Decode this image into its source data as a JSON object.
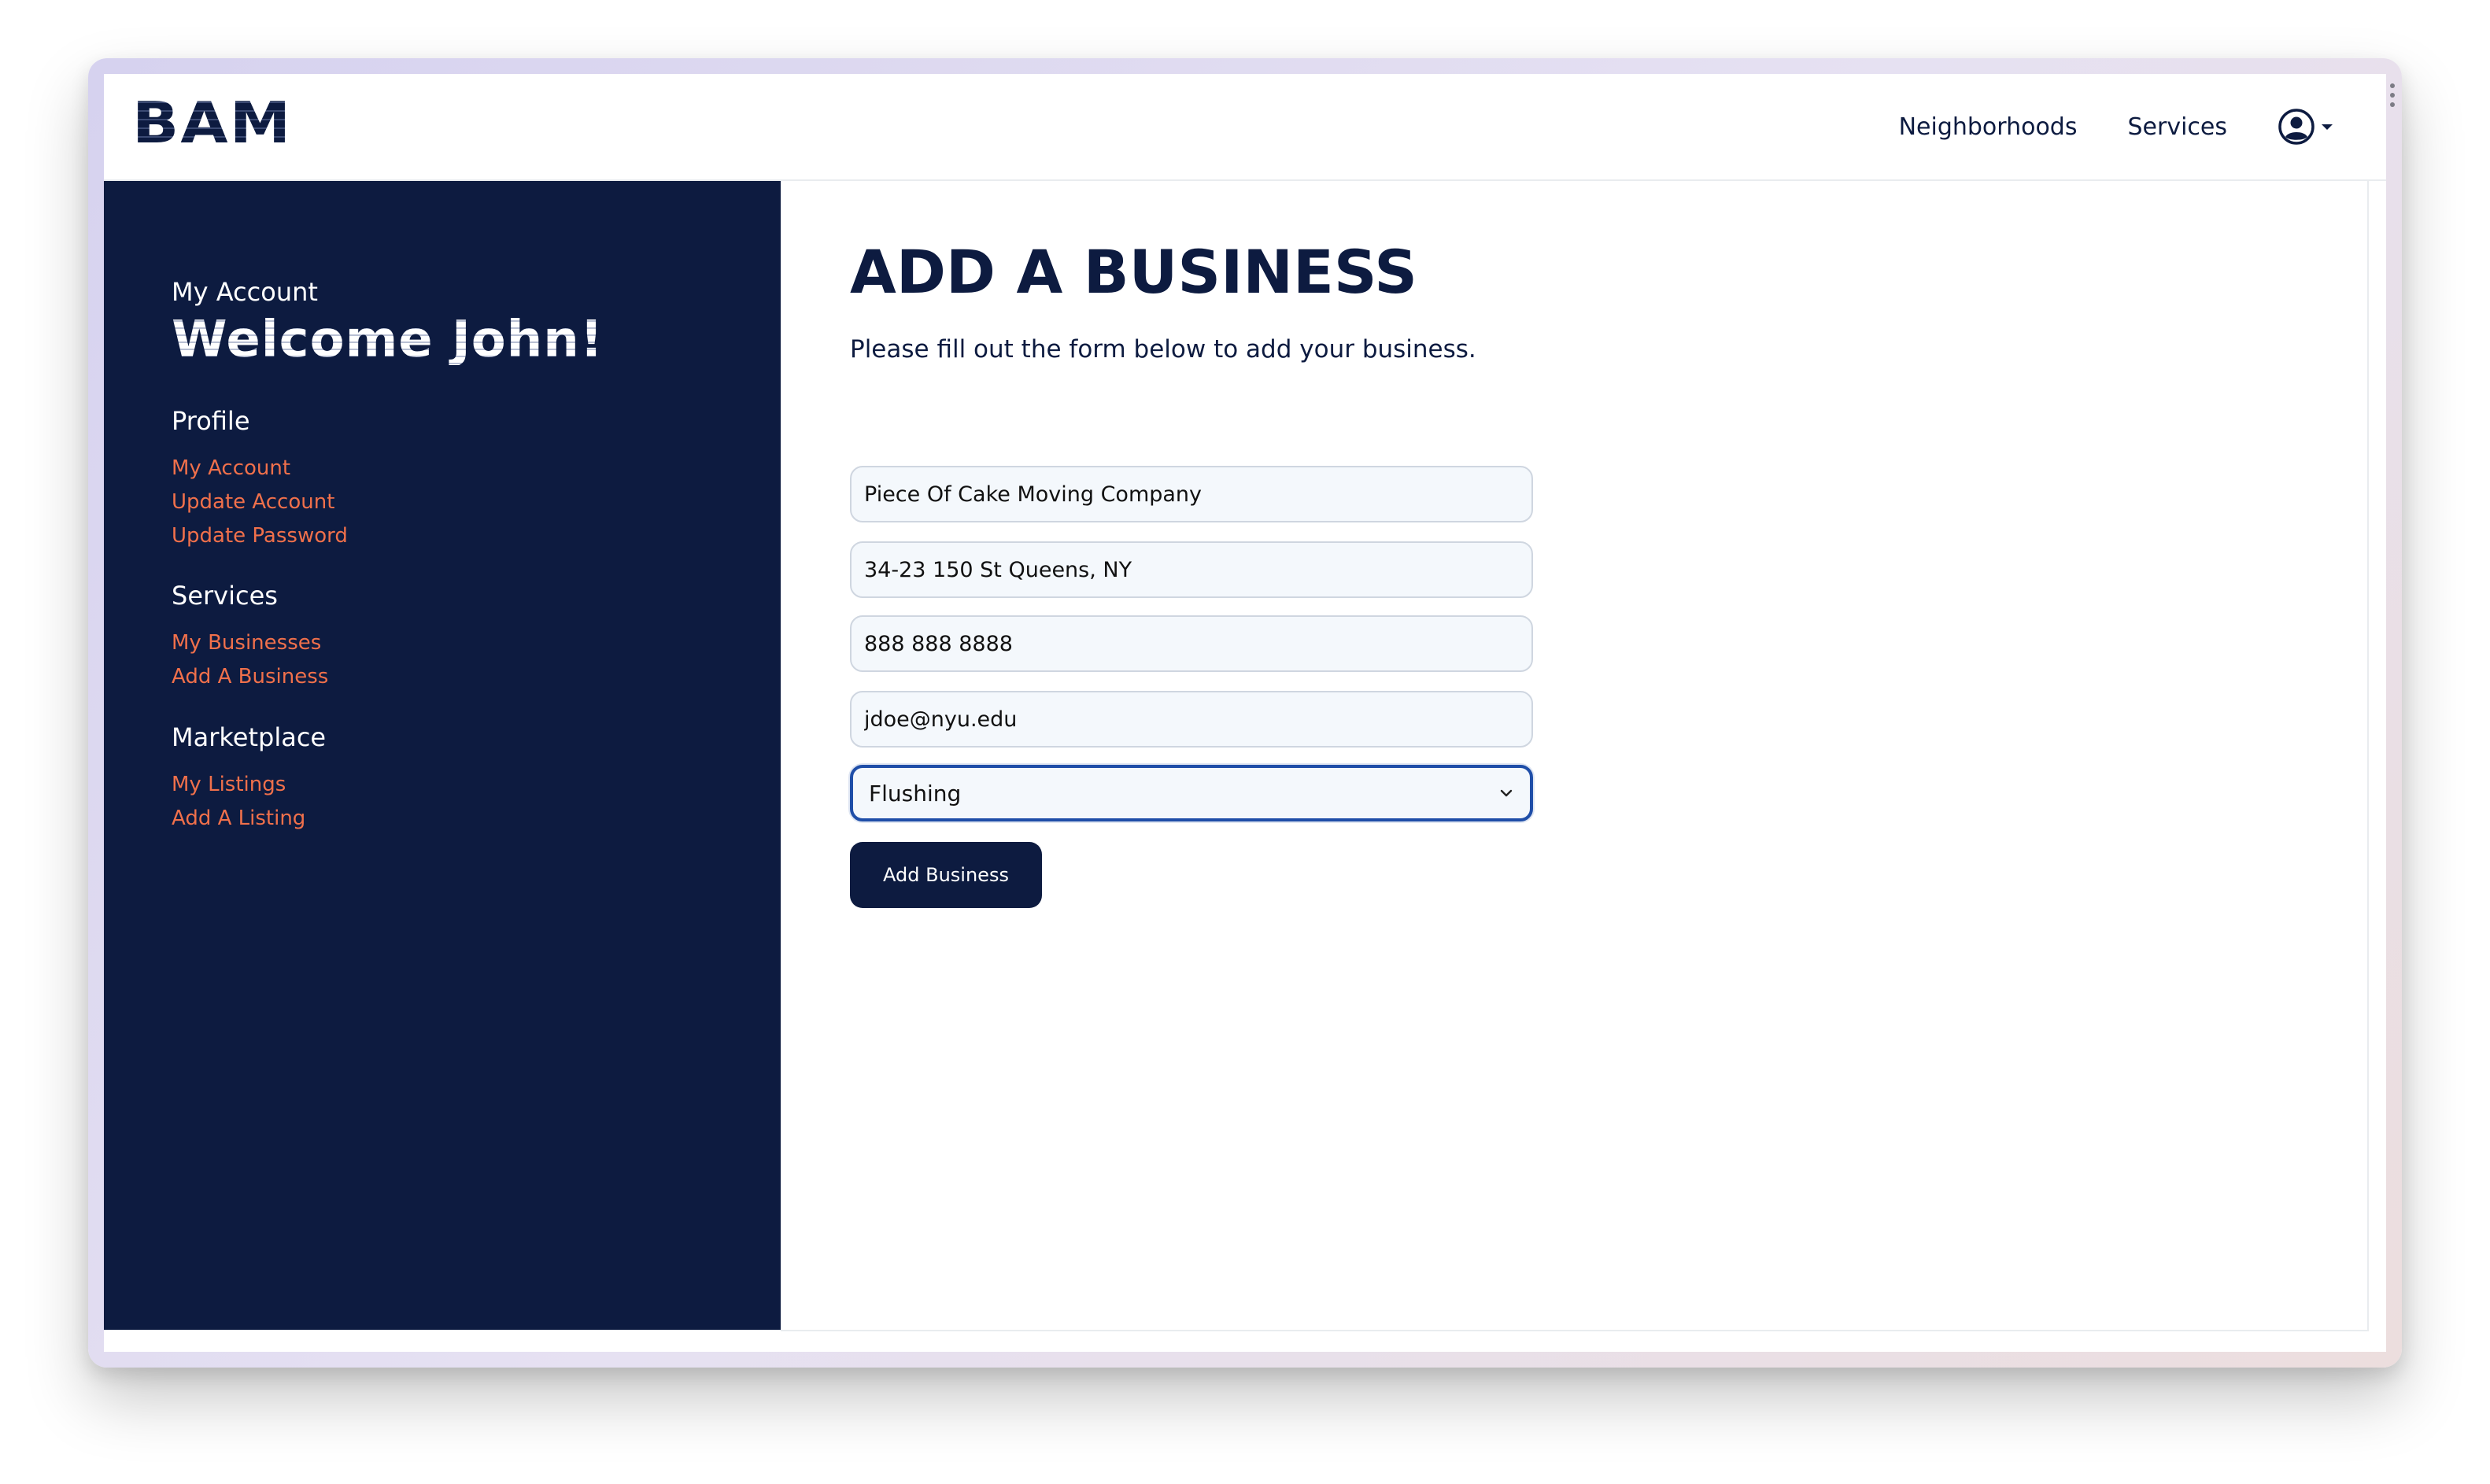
{
  "navbar": {
    "logo": "BAM",
    "links": [
      "Neighborhoods",
      "Services"
    ],
    "user_icon": "user-circle-icon",
    "caret_icon": "caret-down-icon"
  },
  "sidebar": {
    "account_label": "My Account",
    "welcome": "Welcome John!",
    "sections": [
      {
        "heading": "Profile",
        "links": [
          "My Account",
          "Update Account",
          "Update Password"
        ]
      },
      {
        "heading": "Services",
        "links": [
          "My Businesses",
          "Add A Business"
        ]
      },
      {
        "heading": "Marketplace",
        "links": [
          "My Listings",
          "Add A Listing"
        ]
      }
    ]
  },
  "main": {
    "title": "ADD A BUSINESS",
    "subtitle": "Please fill out the form below to add your business.",
    "form": {
      "business_name": "Piece Of Cake Moving Company",
      "address": "34-23 150 St Queens, NY",
      "phone": "888 888 8888",
      "email": "jdoe@nyu.edu",
      "neighborhood_selected": "Flushing",
      "submit_label": "Add Business"
    }
  },
  "colors": {
    "navy": "#0d1b40",
    "link_orange": "#f0704b",
    "focus_blue": "#1f4ea8"
  }
}
